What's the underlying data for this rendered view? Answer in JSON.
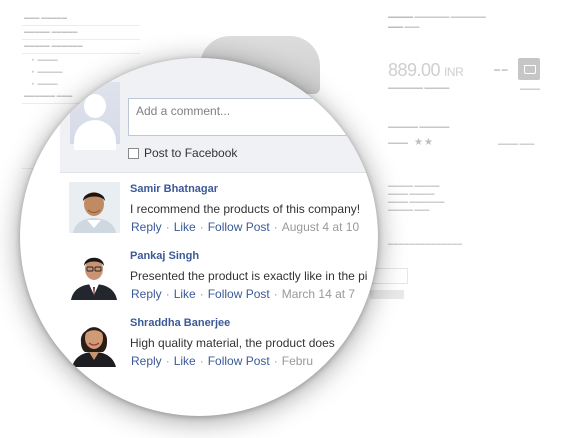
{
  "composer": {
    "placeholder": "Add a comment...",
    "post_to_facebook": "Post to Facebook"
  },
  "comments": [
    {
      "author": "Samir Bhatnagar",
      "text": "I recommend the products of this company!",
      "reply": "Reply",
      "like": "Like",
      "follow": "Follow Post",
      "time": "August 4 at 10"
    },
    {
      "author": "Pankaj Singh",
      "text": "Presented the product is exactly like in the pi",
      "reply": "Reply",
      "like": "Like",
      "follow": "Follow Post",
      "time": "March 14 at 7"
    },
    {
      "author": "Shraddha Banerjee",
      "text": "High quality material, the product does",
      "reply": "Reply",
      "like": "Like",
      "follow": "Follow Post",
      "time": "Febru"
    }
  ],
  "background": {
    "price": "889.00",
    "currency": "INR"
  },
  "colors": {
    "link": "#3b5998",
    "composer_bg": "#f0f1f4",
    "muted": "#999999"
  }
}
